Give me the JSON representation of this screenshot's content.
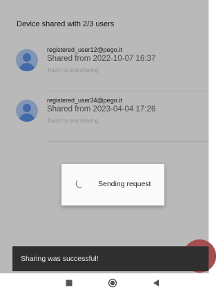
{
  "header": {
    "title": "Device shared with 2/3 users"
  },
  "users": [
    {
      "email": "registered_user12@pego.it",
      "shared": "Shared from 2022-10-07 16:37",
      "hint": "Touch to end sharing",
      "icon": "person-avatar-icon"
    },
    {
      "email": "registered_user34@pego.it",
      "shared": "Shared from 2023-04-04 17:26",
      "hint": "Touch to end sharing",
      "icon": "person-avatar-icon"
    }
  ],
  "dialog": {
    "message": "Sending request",
    "icon": "spinner-icon"
  },
  "snackbar": {
    "message": "Sharing was successful!"
  },
  "fab": {
    "icon": "add-icon",
    "color": "#a34f50"
  },
  "navigation": {
    "icons": [
      "recent-apps-icon",
      "home-icon",
      "back-icon"
    ]
  },
  "colors": {
    "avatar": "#5b8fe0",
    "avatar_bg": "#aecbf3"
  }
}
